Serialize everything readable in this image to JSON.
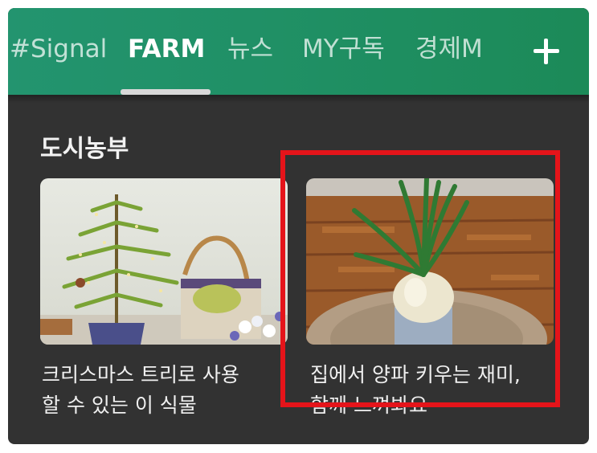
{
  "tabs": [
    {
      "label": "#Signal",
      "active": false
    },
    {
      "label": "FARM",
      "active": true
    },
    {
      "label": "뉴스",
      "active": false
    },
    {
      "label": "MY구독",
      "active": false
    },
    {
      "label": "경제M",
      "active": false
    }
  ],
  "add_tab_icon": "plus-icon",
  "section": {
    "title": "도시농부"
  },
  "cards": [
    {
      "title_line1": "크리스마스 트리로 사용",
      "title_line2": "할 수 있는 이 식물",
      "image": "christmas-tree-plant-photo"
    },
    {
      "title_line1": "집에서 양파 키우는 재미,",
      "title_line2": "함께 느껴봐요",
      "image": "onion-in-bottle-photo"
    }
  ],
  "colors": {
    "tabbar": "#1f8f63",
    "background": "#323232",
    "highlight": "#e5141a"
  }
}
